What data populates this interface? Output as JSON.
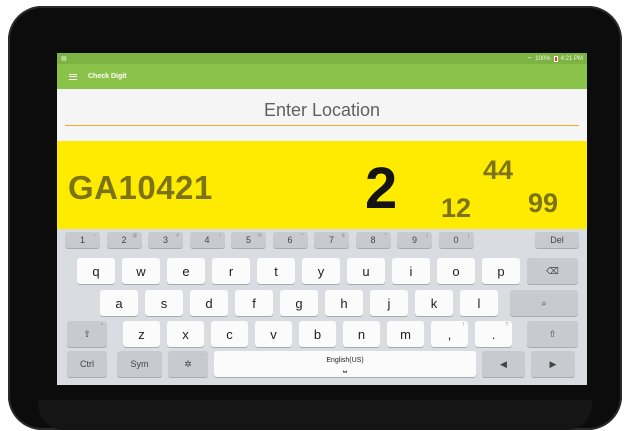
{
  "status_bar": {
    "battery": "100%",
    "time": "4:21 PM"
  },
  "app_bar": {
    "title": "Check Digit"
  },
  "location": {
    "label": "Enter Location"
  },
  "result": {
    "code": "GA10421",
    "check_digit": "2",
    "top_number": "44",
    "left_number": "12",
    "right_number": "99"
  },
  "keyboard": {
    "number_keys": [
      {
        "label": "1",
        "hint": "~"
      },
      {
        "label": "2",
        "hint": "@"
      },
      {
        "label": "3",
        "hint": "#"
      },
      {
        "label": "4",
        "hint": "/"
      },
      {
        "label": "5",
        "hint": "%"
      },
      {
        "label": "6",
        "hint": "^"
      },
      {
        "label": "7",
        "hint": "&"
      },
      {
        "label": "8",
        "hint": "*"
      },
      {
        "label": "9",
        "hint": "("
      },
      {
        "label": "0",
        "hint": ")"
      }
    ],
    "del_label": "Del",
    "row_q": [
      "q",
      "w",
      "e",
      "r",
      "t",
      "y",
      "u",
      "i",
      "o",
      "p"
    ],
    "row_a": [
      "a",
      "s",
      "d",
      "f",
      "g",
      "h",
      "j",
      "k",
      "l"
    ],
    "row_z": [
      "z",
      "x",
      "c",
      "v",
      "b",
      "n",
      "m",
      ",",
      "."
    ],
    "row_z_hints": [
      "",
      "",
      "",
      "",
      "",
      "",
      "",
      "!",
      "?"
    ],
    "ctrl_label": "Ctrl",
    "sym_label": "Sym",
    "space_label": "English(US)",
    "settings_hint": "···"
  }
}
